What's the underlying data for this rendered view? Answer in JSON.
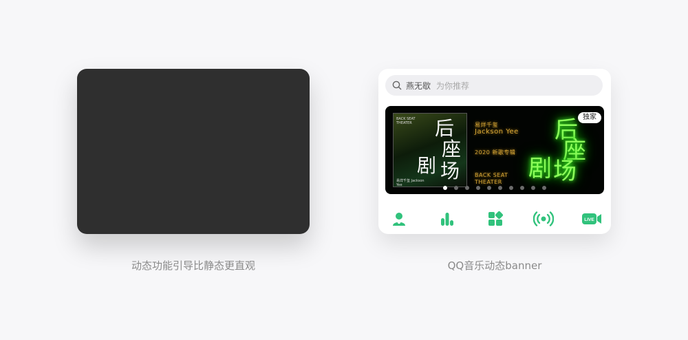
{
  "left_caption": "动态功能引导比静态更直观",
  "right_caption": "QQ音乐动态banner",
  "search": {
    "query": "燕无歇",
    "placeholder": "为你推荐"
  },
  "banner": {
    "badge": "独家",
    "album_top_text": "BACK SEAT THEATER",
    "album_bottom_text": "易烊千玺 Jackson Yee",
    "album_title_line1": "后",
    "album_title_line2": "座",
    "album_title_line3": "剧",
    "album_title_line4": "场",
    "artist_cn": "易烊千玺",
    "artist_en": "Jackson Yee",
    "release": "2020 新歌专辑",
    "album_en_line1": "BACK SEAT",
    "album_en_line2": "THEATER",
    "neon_line1": "后",
    "neon_line2": "座",
    "neon_line3": "剧",
    "neon_line4": "场",
    "slide_count": 10,
    "active_slide": 1
  },
  "nav_icons": [
    "singer-icon",
    "chart-icon",
    "category-icon",
    "radio-icon",
    "live-icon"
  ],
  "live_label": "LIVE",
  "colors": {
    "accent": "#31c27c",
    "neon": "#8dff5a",
    "gold": "#d7a636",
    "dark_card": "#2f2f2f"
  }
}
